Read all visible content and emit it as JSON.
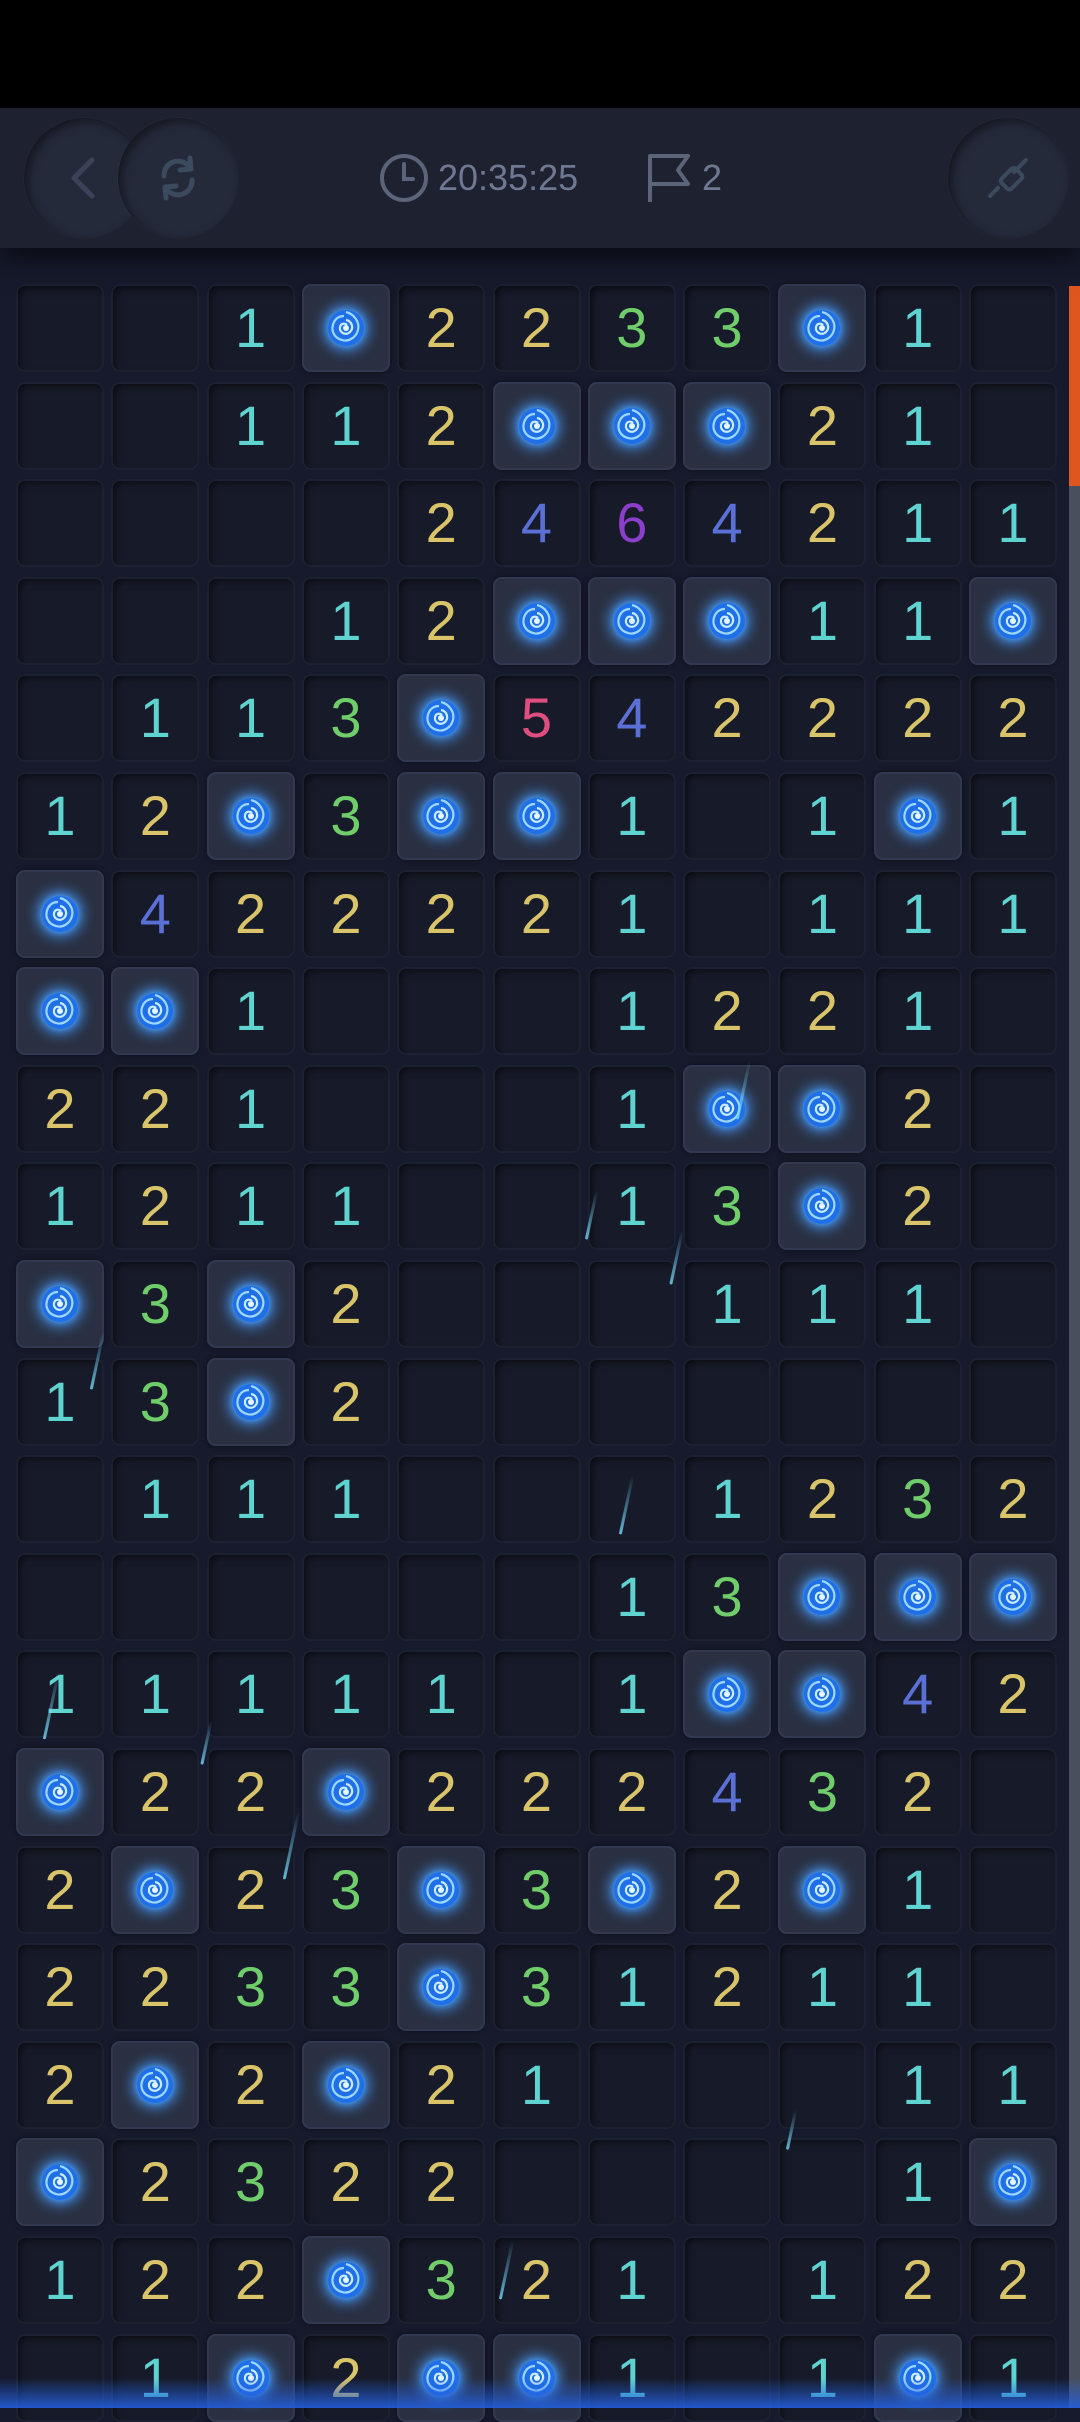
{
  "header": {
    "timer": "20:35:25",
    "flags": "2",
    "icons": [
      "back-chevron-icon",
      "restart-icon",
      "clock-icon",
      "flag-icon",
      "shovel-icon"
    ]
  },
  "board": {
    "cols": 11,
    "rows": [
      [
        "",
        "",
        "1",
        "M",
        "2",
        "2",
        "3",
        "3",
        "M",
        "1",
        ""
      ],
      [
        "",
        "",
        "1",
        "1",
        "2",
        "M",
        "M",
        "M",
        "2",
        "1",
        ""
      ],
      [
        "",
        "",
        "",
        "",
        "2",
        "4",
        "6",
        "4",
        "2",
        "1",
        "1"
      ],
      [
        "",
        "",
        "",
        "1",
        "2",
        "M",
        "M",
        "M",
        "1",
        "1",
        "M"
      ],
      [
        "",
        "1",
        "1",
        "3",
        "M",
        "5",
        "4",
        "2",
        "2",
        "2",
        "2"
      ],
      [
        "1",
        "2",
        "M",
        "3",
        "M",
        "M",
        "1",
        "",
        "1",
        "M",
        "1"
      ],
      [
        "M",
        "4",
        "2",
        "2",
        "2",
        "2",
        "1",
        "",
        "1",
        "1",
        "1"
      ],
      [
        "M",
        "M",
        "1",
        "",
        "",
        "",
        "1",
        "2",
        "2",
        "1",
        ""
      ],
      [
        "2",
        "2",
        "1",
        "",
        "",
        "",
        "1",
        "M",
        "M",
        "2",
        ""
      ],
      [
        "1",
        "2",
        "1",
        "1",
        "",
        "",
        "1",
        "3",
        "M",
        "2",
        ""
      ],
      [
        "M",
        "3",
        "M",
        "2",
        "",
        "",
        "",
        "1",
        "1",
        "1",
        ""
      ],
      [
        "1",
        "3",
        "M",
        "2",
        "",
        "",
        "",
        "",
        "",
        "",
        ""
      ],
      [
        "",
        "1",
        "1",
        "1",
        "",
        "",
        "",
        "1",
        "2",
        "3",
        "2"
      ],
      [
        "",
        "",
        "",
        "",
        "",
        "",
        "1",
        "3",
        "M",
        "M",
        "M"
      ],
      [
        "1",
        "1",
        "1",
        "1",
        "1",
        "",
        "1",
        "M",
        "M",
        "4",
        "2"
      ],
      [
        "M",
        "2",
        "2",
        "M",
        "2",
        "2",
        "2",
        "4",
        "3",
        "2",
        ""
      ],
      [
        "2",
        "M",
        "2",
        "3",
        "M",
        "3",
        "M",
        "2",
        "M",
        "1",
        ""
      ],
      [
        "2",
        "2",
        "3",
        "3",
        "M",
        "3",
        "1",
        "2",
        "1",
        "1",
        ""
      ],
      [
        "2",
        "M",
        "2",
        "M",
        "2",
        "1",
        "",
        "",
        "",
        "1",
        "1"
      ],
      [
        "M",
        "2",
        "3",
        "2",
        "2",
        "",
        "",
        "",
        "",
        "1",
        "M"
      ],
      [
        "1",
        "2",
        "2",
        "M",
        "3",
        "2",
        "1",
        "",
        "1",
        "2",
        "2"
      ],
      [
        "",
        "1",
        "M",
        "2",
        "M",
        "M",
        "1",
        "",
        "1",
        "M",
        "1"
      ]
    ]
  },
  "colors": {
    "n1": "#5fd3d0",
    "n2": "#d9c46a",
    "n3": "#6fce6a",
    "n4": "#5b70d6",
    "n5": "#e04e7f",
    "n6": "#8a3ec9",
    "mine_glow": "#2f8bff",
    "scroll_thumb": "#e0561f"
  }
}
